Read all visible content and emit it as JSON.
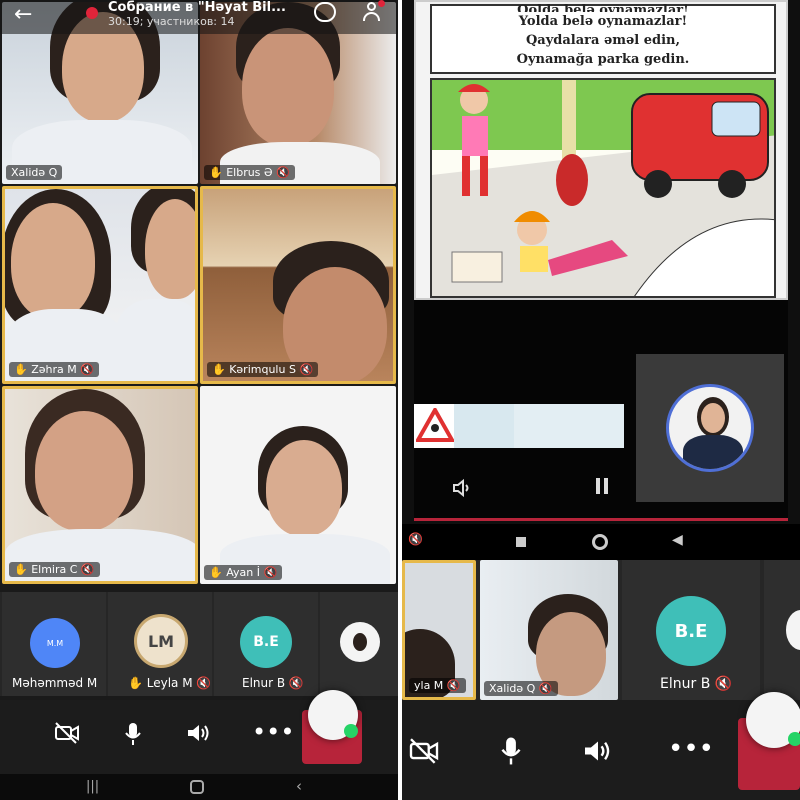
{
  "left": {
    "header": {
      "back_icon": "arrow-left-icon",
      "title": "Собрание в \"Həyat Bil...",
      "subtitle": "30:19; участников: 14",
      "recording_color": "#e0243a"
    },
    "tiles": [
      {
        "name": "Xalidə Q",
        "active": false
      },
      {
        "name": "Elbrus Ə",
        "active": false
      },
      {
        "name": "Zəhra M",
        "active": true
      },
      {
        "name": "Kərimqulu S",
        "active": true
      },
      {
        "name": "Elmira C",
        "active": true
      },
      {
        "name": "Ayan İ",
        "active": false
      }
    ],
    "participants": [
      {
        "name": "Məhəmməd M",
        "initials": "M.M",
        "color": "#4f86f7"
      },
      {
        "name": "Leyla M",
        "initials": "LM",
        "color": "#6b5a4a"
      },
      {
        "name": "Elnur B",
        "initials": "B.E",
        "color": "#3fbfb8"
      },
      {
        "name": "",
        "initials": "",
        "color": "#ffffff"
      }
    ],
    "accent": "#e6b94a"
  },
  "right": {
    "slide_lines": [
      "Qolda belə oynamazlar!",
      "Yolda belə oynamazlar!",
      "Qaydalara  əməl  edin,",
      "Oynamağa parka gedin."
    ],
    "participants": [
      {
        "name": "yla M"
      },
      {
        "name": "Xalidə Q"
      },
      {
        "name": "Elnur B",
        "initials": "B.E",
        "color": "#3fbfb8"
      }
    ]
  },
  "end_color": "#b7243a"
}
